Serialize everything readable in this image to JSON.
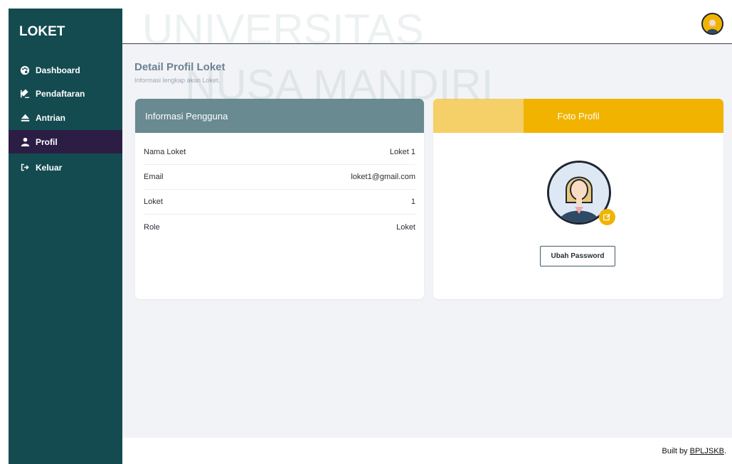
{
  "sidebar": {
    "brand": "LOKET",
    "items": [
      {
        "label": "Dashboard",
        "icon": "palette-icon"
      },
      {
        "label": "Pendaftaran",
        "icon": "signature-icon"
      },
      {
        "label": "Antrian",
        "icon": "eject-icon"
      },
      {
        "label": "Profil",
        "icon": "user-icon",
        "active": true
      },
      {
        "label": "Keluar",
        "icon": "sign-out-icon"
      }
    ]
  },
  "watermark": {
    "line1": "UNIVERSITAS",
    "line2": "NUSA MANDIRI"
  },
  "page": {
    "title": "Detail Profil Loket",
    "subtitle": "Informasi lengkap akun Loket."
  },
  "user_info": {
    "heading": "Informasi Pengguna",
    "rows": [
      {
        "label": "Nama Loket",
        "value": "Loket 1"
      },
      {
        "label": "Email",
        "value": "loket1@gmail.com"
      },
      {
        "label": "Loket",
        "value": "1"
      },
      {
        "label": "Role",
        "value": "Loket"
      }
    ]
  },
  "profile_photo": {
    "heading": "Foto Profil",
    "change_password_label": "Ubah Password"
  },
  "footer": {
    "prefix": "Built by ",
    "link": "BPLJSKB",
    "suffix": "."
  },
  "colors": {
    "sidebar": "#134b50",
    "active_item": "#2b1d44",
    "card_header_left": "#688a90",
    "card_header_right": "#f1b300",
    "main_bg": "#f2f3f6"
  }
}
